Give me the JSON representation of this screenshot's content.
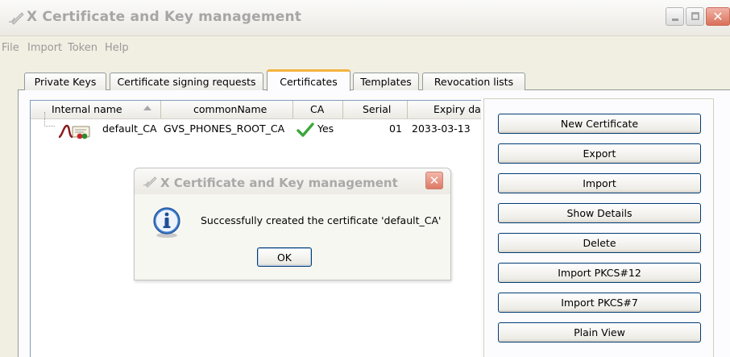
{
  "window": {
    "title": "X Certificate and Key management",
    "app_icon": "certificate-pen-icon",
    "controls": {
      "minimize_icon": "minimize-icon",
      "maximize_icon": "maximize-icon",
      "close_icon": "close-icon",
      "close_glyph": "✕"
    }
  },
  "menu": {
    "items": [
      "File",
      "Import",
      "Token",
      "Help"
    ]
  },
  "tabs": [
    {
      "label": "Private Keys"
    },
    {
      "label": "Certificate signing requests"
    },
    {
      "label": "Certificates",
      "active": true
    },
    {
      "label": "Templates"
    },
    {
      "label": "Revocation lists"
    }
  ],
  "table": {
    "columns": [
      "Internal name",
      "commonName",
      "CA",
      "Serial",
      "Expiry da"
    ],
    "sort_column": "Internal name",
    "sort_icon": "sort-ascending-icon",
    "rows": [
      {
        "internal_name": "default_CA",
        "common_name": "GVS_PHONES_ROOT_CA",
        "ca": "Yes",
        "ca_icon": "checkmark-icon",
        "serial": "01",
        "expiry": "2033-03-13",
        "icon": "certificate-icon"
      }
    ]
  },
  "buttons": {
    "new_certificate": "New Certificate",
    "export": "Export",
    "import": "Import",
    "show_details": "Show Details",
    "delete": "Delete",
    "import_pkcs12": "Import PKCS#12",
    "import_pkcs7": "Import PKCS#7",
    "plain_view": "Plain View"
  },
  "dialog": {
    "title": "X Certificate and Key management",
    "icon": "info-icon",
    "message": "Successfully created the certificate 'default_CA'",
    "ok_label": "OK",
    "close_glyph": "✕"
  },
  "colors": {
    "tab_active_accent": "#f4b33f",
    "check_green": "#3aa83a",
    "close_red": "#dd7965",
    "button_border": "#003c74"
  }
}
